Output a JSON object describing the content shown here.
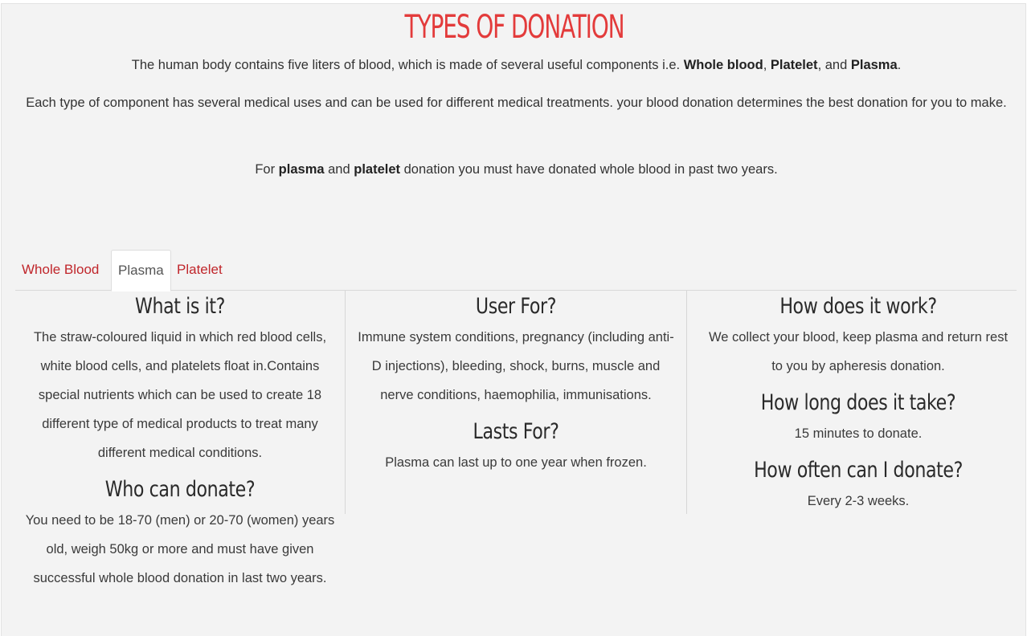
{
  "title": "TYPES OF DONATION",
  "intro": {
    "p1_a": "The human body contains five liters of blood, which is made of several useful components i.e. ",
    "p1_b": "Whole blood",
    "p1_c": ", ",
    "p1_d": "Platelet",
    "p1_e": ", and ",
    "p1_f": "Plasma",
    "p1_g": ".",
    "p2": "Each type of component has several medical uses and can be used for different medical treatments. your blood donation determines the best donation for you to make.",
    "p3_a": "For ",
    "p3_b": "plasma",
    "p3_c": " and ",
    "p3_d": "platelet",
    "p3_e": " donation you must have donated whole blood in past two years."
  },
  "tabs": [
    {
      "label": "Whole Blood",
      "active": false
    },
    {
      "label": "Plasma",
      "active": true
    },
    {
      "label": "Platelet",
      "active": false
    }
  ],
  "columns": {
    "c1": {
      "h1": "What is it?",
      "t1": "The straw-coloured liquid in which red blood cells, white blood cells, and platelets float in.Contains special nutrients which can be used to create 18 different type of medical products to treat many different medical conditions.",
      "h2": "Who can donate?",
      "t2": "You need to be 18-70 (men) or 20-70 (women) years old, weigh 50kg or more and must have given successful whole blood donation in last two years."
    },
    "c2": {
      "h1": "User For?",
      "t1": "Immune system conditions, pregnancy (including anti-D injections), bleeding, shock, burns, muscle and nerve conditions, haemophilia, immunisations.",
      "h2": "Lasts For?",
      "t2": "Plasma can last up to one year when frozen."
    },
    "c3": {
      "h1": "How does it work?",
      "t1": "We collect your blood, keep plasma and return rest to you by apheresis donation.",
      "h2": "How long does it take?",
      "t2": "15 minutes to donate.",
      "h3": "How often can I donate?",
      "t3": "Every 2-3 weeks."
    }
  },
  "colors": {
    "title": "#e33b3b",
    "tab_link": "#c0262b",
    "background": "#f3f3f3"
  }
}
